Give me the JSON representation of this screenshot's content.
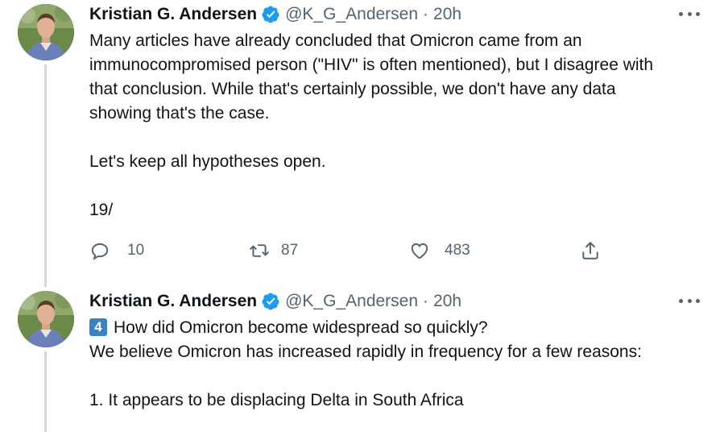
{
  "tweets": [
    {
      "author_name": "Kristian G. Andersen",
      "handle": "@K_G_Andersen",
      "separator": "·",
      "time": "20h",
      "lines": [
        "Many articles have already concluded that Omicron came from an",
        "immunocompromised person (\"HIV\" is often mentioned), but I disagree with",
        "that conclusion. While that's certainly possible, we don't have any data",
        "showing that's the case.",
        "",
        "Let's keep all hypotheses open.",
        "",
        "19/"
      ],
      "replies": "10",
      "retweets": "87",
      "likes": "483"
    },
    {
      "author_name": "Kristian G. Andersen",
      "handle": "@K_G_Andersen",
      "separator": "·",
      "time": "20h",
      "badge": "4",
      "first_line": "How did Omicron become widespread so quickly?",
      "lines": [
        "We believe Omicron has increased rapidly in frequency for a few reasons:",
        "",
        "1. It appears to be displacing Delta in South Africa"
      ]
    }
  ],
  "colors": {
    "verified": "#1d9bf0",
    "secondary_text": "#536471",
    "thread_line": "#cfd9de",
    "badge": "#3b82c4"
  },
  "icons": [
    "verified-badge-icon",
    "more-options-icon",
    "reply-icon",
    "retweet-icon",
    "like-icon",
    "share-icon"
  ]
}
